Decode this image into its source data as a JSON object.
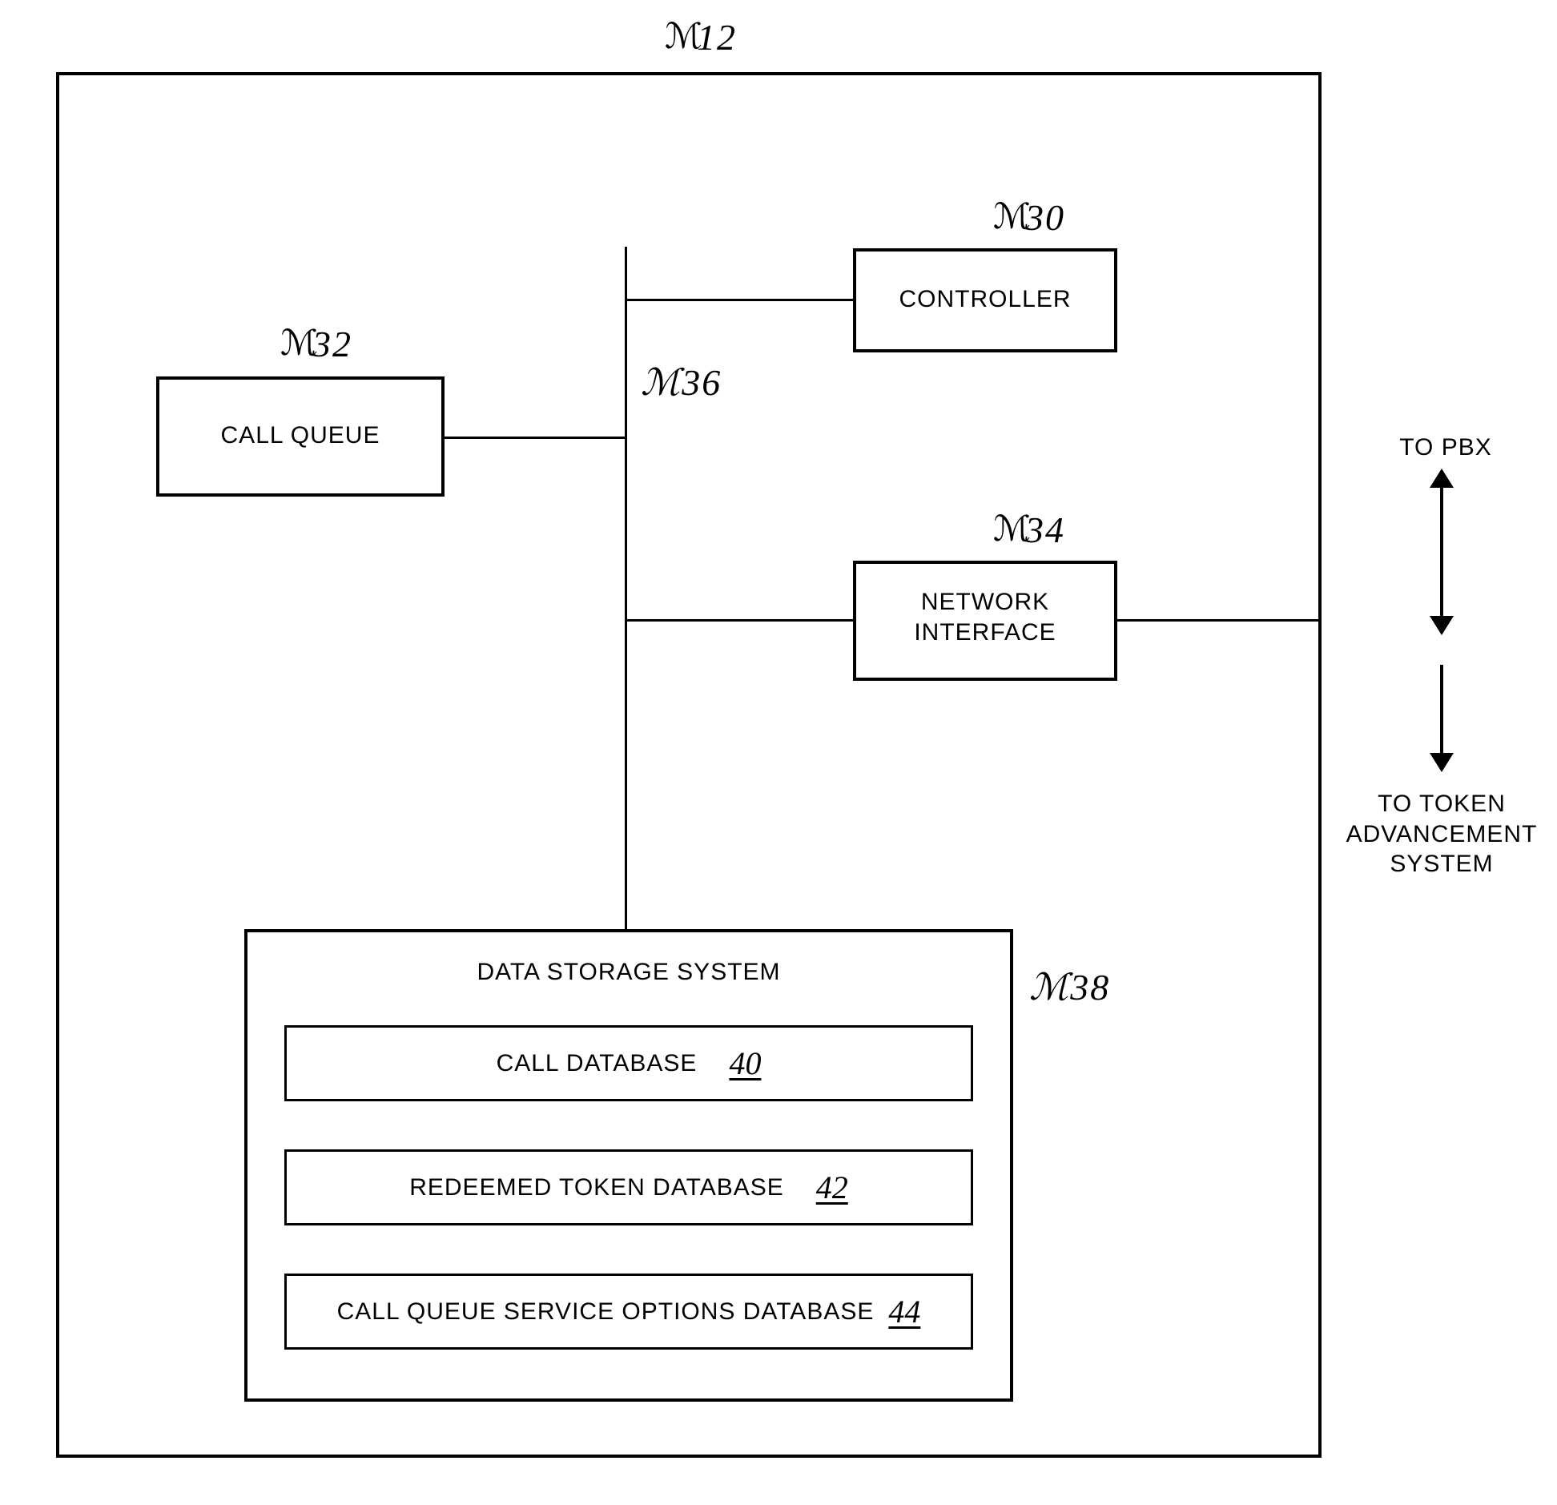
{
  "refs": {
    "outer": "12",
    "controller": "30",
    "call_queue": "32",
    "network_interface": "34",
    "bus": "36",
    "data_storage": "38",
    "call_db": "40",
    "redeemed_db": "42",
    "options_db": "44"
  },
  "blocks": {
    "controller": "CONTROLLER",
    "call_queue": "CALL QUEUE",
    "network_interface_line1": "NETWORK",
    "network_interface_line2": "INTERFACE",
    "data_storage_title": "DATA STORAGE SYSTEM",
    "call_db": "CALL DATABASE",
    "redeemed_db": "REDEEMED TOKEN DATABASE",
    "options_db": "CALL QUEUE SERVICE OPTIONS DATABASE"
  },
  "ext": {
    "to_pbx": "TO PBX",
    "to_token_line1": "TO TOKEN",
    "to_token_line2": "ADVANCEMENT",
    "to_token_line3": "SYSTEM"
  }
}
